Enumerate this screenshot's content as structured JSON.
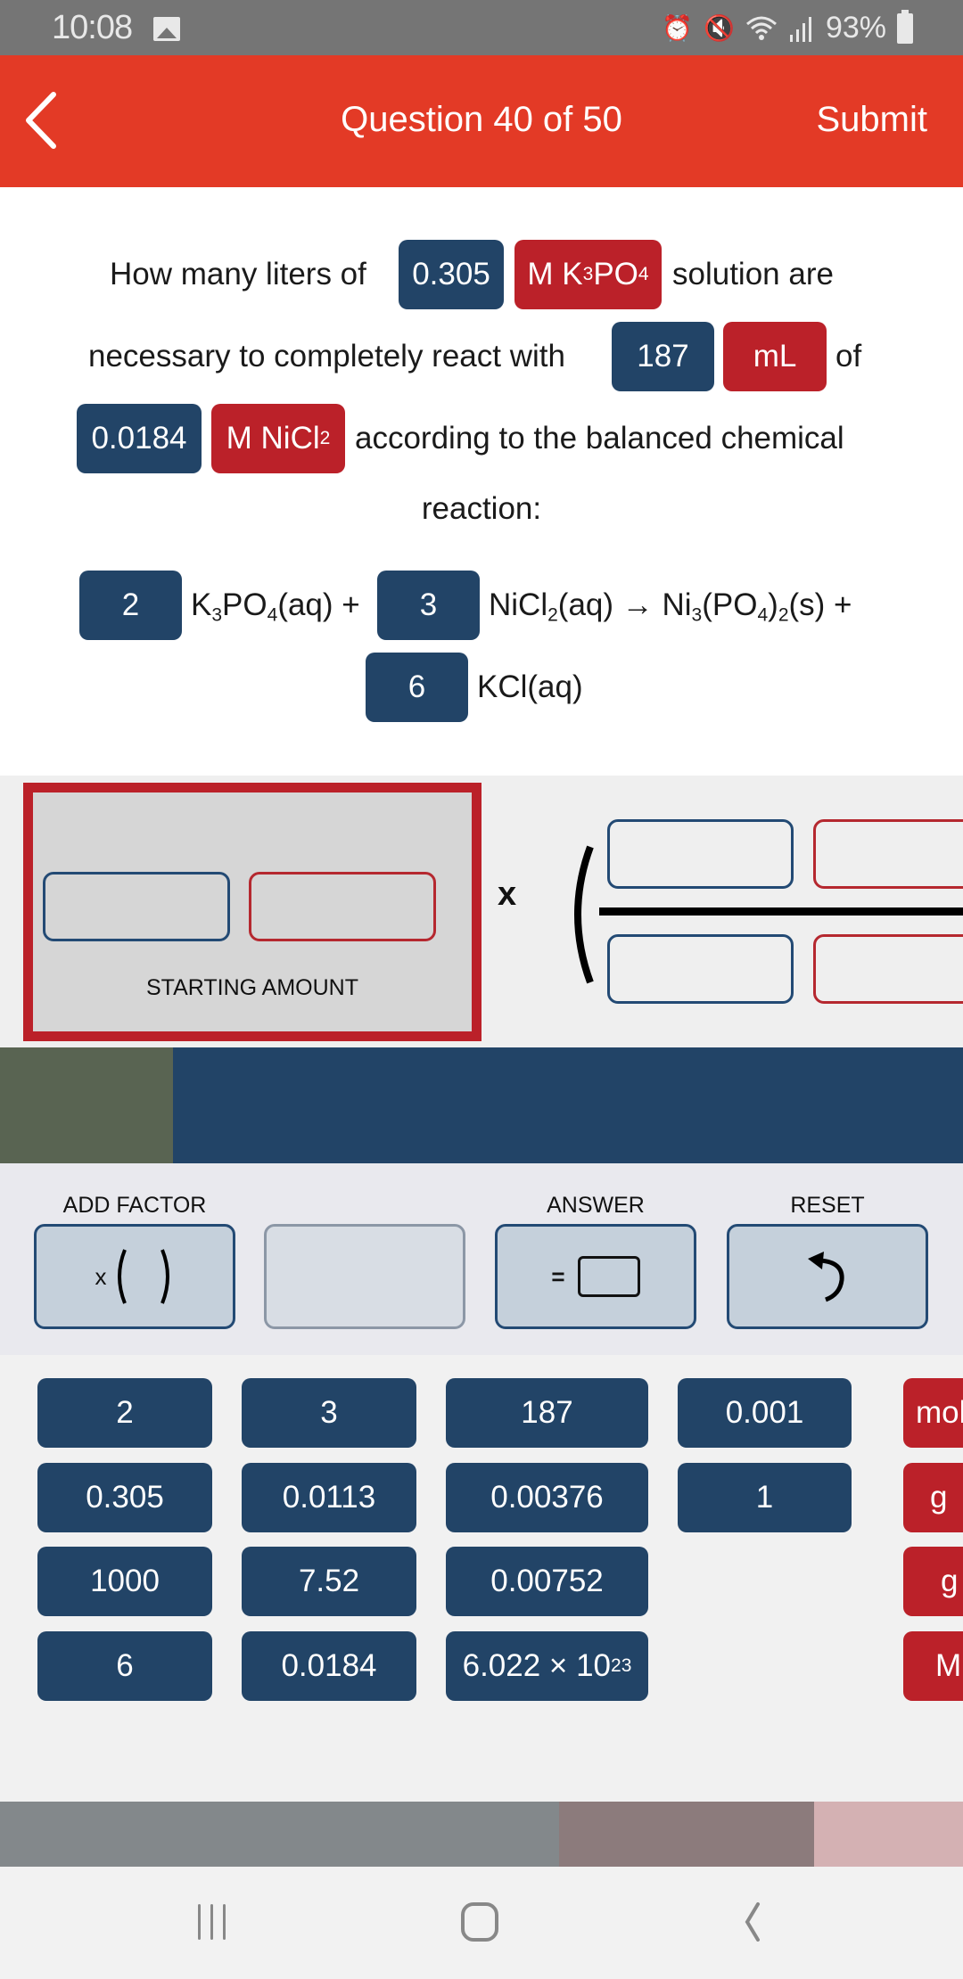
{
  "status_bar": {
    "time": "10:08",
    "battery": "93%",
    "icons": [
      "gallery-icon",
      "alarm-icon",
      "mute-icon",
      "wifi-icon",
      "signal-icon",
      "battery-icon"
    ]
  },
  "app_bar": {
    "title": "Question 40 of 50",
    "submit_label": "Submit",
    "color": "#e33a26"
  },
  "question": {
    "line1_pre": "How many liters of",
    "value1": "0.305",
    "unit1_main": "M K",
    "unit1_sub1": "3",
    "unit1_mid": "PO",
    "unit1_sub2": "4",
    "line1_post": "solution are",
    "line2_pre": "necessary to completely react with",
    "value2": "187",
    "unit2": "mL",
    "line2_post": "of",
    "value3": "0.0184",
    "unit3_main": "M NiCl",
    "unit3_sub": "2",
    "line3_post": "according to the balanced chemical",
    "line4": "reaction:",
    "equation": {
      "coef1": "2",
      "species1_a": "K",
      "species1_s1": "3",
      "species1_b": "PO",
      "species1_s2": "4",
      "species1_c": "(aq) +",
      "coef2": "3",
      "species2_a": "NiCl",
      "species2_s1": "2",
      "species2_b": "(aq) → Ni",
      "species2_s2": "3",
      "species2_c": "(PO",
      "species2_s3": "4",
      "species2_d": ")",
      "species2_s4": "2",
      "species2_e": "(s) +",
      "coef3": "6",
      "species3": "KCl(aq)"
    }
  },
  "workspace": {
    "starting_label": "STARTING AMOUNT",
    "times_sign": "x"
  },
  "progress": {
    "fraction": 0.18,
    "fill_color": "#596452",
    "track_color": "#224467"
  },
  "tools": {
    "add_factor_label": "ADD FACTOR",
    "add_factor_x": "x",
    "answer_label": "ANSWER",
    "answer_eq": "=",
    "reset_label": "RESET"
  },
  "keypad": {
    "numbers": [
      [
        "2",
        "3",
        "187",
        "0.001"
      ],
      [
        "0.305",
        "0.0113",
        "0.00376",
        "1"
      ],
      [
        "1000",
        "7.52",
        "0.00752"
      ],
      [
        "6",
        "0.0184",
        "6.022 × 10"
      ]
    ],
    "avogadro_exponent": "23",
    "units": [
      "mol",
      "g",
      "g",
      "M"
    ]
  },
  "bottom_strip": {
    "colors": [
      "#83888b",
      "#8c7b7c",
      "#d4b1b3"
    ]
  },
  "nav_bar": {
    "icons": [
      "recent-apps-icon",
      "home-icon",
      "back-icon"
    ]
  }
}
